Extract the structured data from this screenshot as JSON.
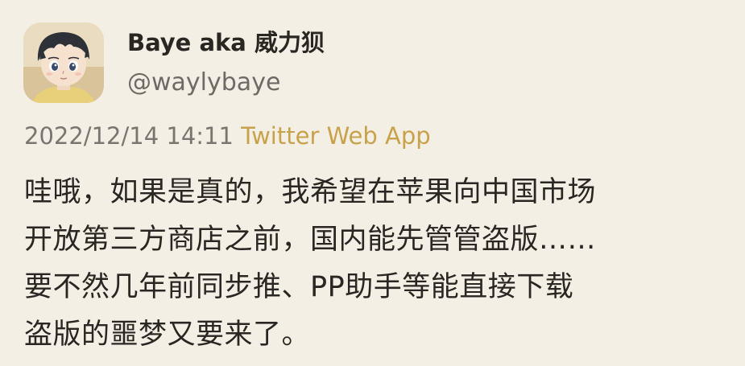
{
  "user": {
    "display_name": "Baye aka 威力狈",
    "handle": "@waylybaye",
    "avatar_icon": "anime-boy-avatar"
  },
  "meta": {
    "timestamp": "2022/12/14 14:11",
    "source": "Twitter Web App"
  },
  "content": {
    "lines": [
      "哇哦，如果是真的，我希望在苹果向中国市场",
      "开放第三方商店之前，国内能先管管盗版……",
      "要不然几年前同步推、PP助手等能直接下载",
      "盗版的噩梦又要来了。"
    ]
  },
  "colors": {
    "background": "#f4efe4",
    "text": "#2a2622",
    "muted": "#7a756f",
    "source_link": "#c7a24a"
  }
}
